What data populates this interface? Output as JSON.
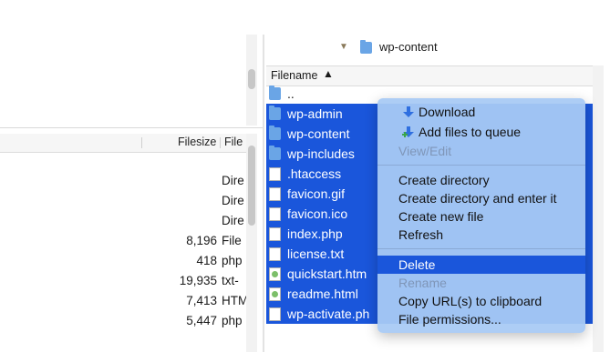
{
  "left_panel": {
    "columns": {
      "filesize": "Filesize",
      "filetype": "File"
    },
    "rows": [
      {
        "size": "",
        "type": "Dire"
      },
      {
        "size": "",
        "type": "Dire"
      },
      {
        "size": "",
        "type": "Dire"
      },
      {
        "size": "8,196",
        "type": "File"
      },
      {
        "size": "418",
        "type": "php"
      },
      {
        "size": "19,935",
        "type": "txt-"
      },
      {
        "size": "7,413",
        "type": "HTM"
      },
      {
        "size": "5,447",
        "type": "php"
      }
    ]
  },
  "right_panel": {
    "path": "wp-content",
    "header": {
      "filename": "Filename",
      "sort_caret": "^"
    },
    "rows": [
      {
        "name": "..",
        "icon": "folder-icon",
        "selected": false
      },
      {
        "name": "wp-admin",
        "icon": "folder-icon",
        "selected": true
      },
      {
        "name": "wp-content",
        "icon": "folder-icon",
        "selected": true
      },
      {
        "name": "wp-includes",
        "icon": "folder-icon",
        "selected": true
      },
      {
        "name": ".htaccess",
        "icon": "file-icon",
        "selected": true
      },
      {
        "name": "favicon.gif",
        "icon": "file-icon",
        "selected": true
      },
      {
        "name": "favicon.ico",
        "icon": "file-icon",
        "selected": true
      },
      {
        "name": "index.php",
        "icon": "file-icon",
        "selected": true
      },
      {
        "name": "license.txt",
        "icon": "file-icon",
        "selected": true
      },
      {
        "name": "quickstart.htm",
        "icon": "html-file-icon",
        "selected": true
      },
      {
        "name": "readme.html",
        "icon": "html-file-icon",
        "selected": true
      },
      {
        "name": "wp-activate.ph",
        "icon": "file-icon",
        "selected": true
      }
    ]
  },
  "context_menu": {
    "download": "Download",
    "add_to_queue": "Add files to queue",
    "view_edit": "View/Edit",
    "create_directory": "Create directory",
    "create_directory_enter": "Create directory and enter it",
    "create_new_file": "Create new file",
    "refresh": "Refresh",
    "delete": "Delete",
    "rename": "Rename",
    "copy_urls": "Copy URL(s) to clipboard",
    "file_permissions": "File permissions..."
  },
  "colors": {
    "selection": "#1a56db",
    "menu_background": "#a8caf4",
    "folder": "#6aa5e6"
  }
}
